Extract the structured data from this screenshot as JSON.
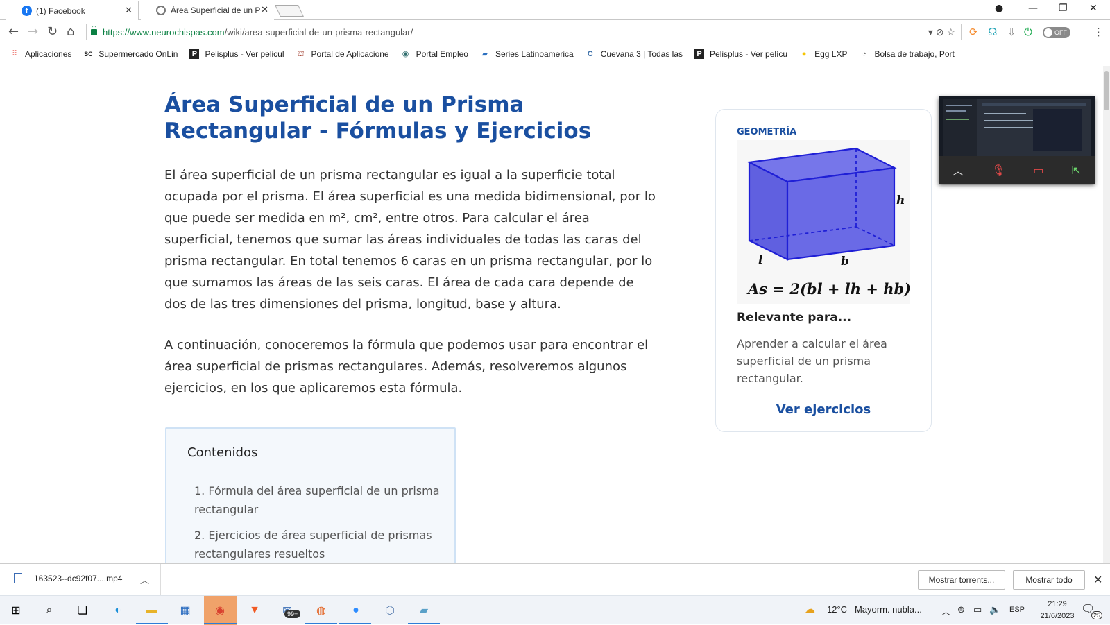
{
  "browser": {
    "tabs": [
      {
        "title": "(1) Facebook",
        "icon": "facebook-icon"
      },
      {
        "title": "Área Superficial de un Pri",
        "icon": "neurochispas-icon"
      }
    ],
    "url_host": "https://www.neurochispas.com",
    "url_path": "/wiki/area-superficial-de-un-prisma-rectangular/",
    "extension_toggle": "OFF"
  },
  "bookmarks": [
    {
      "label": "Aplicaciones",
      "icon": "apps-grid-icon",
      "color": "#e8453c"
    },
    {
      "label": "Supermercado OnLin",
      "icon": "sc-icon",
      "color": "#333333"
    },
    {
      "label": "Pelisplus - Ver pelicul",
      "icon": "pelisplus-icon",
      "color": "#222222"
    },
    {
      "label": "Portal de Aplicacione",
      "icon": "portal-icon",
      "color": "#a84b3c"
    },
    {
      "label": "Portal Empleo",
      "icon": "empleo-icon",
      "color": "#2f6d6d"
    },
    {
      "label": "Series Latinoamerica",
      "icon": "series-icon",
      "color": "#2a6fbf"
    },
    {
      "label": "Cuevana 3 | Todas las",
      "icon": "cuevana-icon",
      "color": "#3a6ea8"
    },
    {
      "label": "Pelisplus - Ver pelícu",
      "icon": "pelisplus-icon",
      "color": "#222222"
    },
    {
      "label": "Egg LXP",
      "icon": "egg-icon",
      "color": "#f5c400"
    },
    {
      "label": "Bolsa de trabajo, Port",
      "icon": "bolsa-icon",
      "color": "#666666"
    }
  ],
  "article": {
    "title": "Área Superficial de un Prisma Rectangular - Fórmulas y Ejercicios",
    "paragraph1": "El área superficial de un prisma rectangular es igual a la superficie total ocupada por el prisma. El área superficial es una medida bidimensional, por lo que puede ser medida en m², cm², entre otros. Para calcular el área superficial, tenemos que sumar las áreas individuales de todas las caras del prisma rectangular. En total tenemos 6 caras en un prisma rectangular, por lo que sumamos las áreas de las seis caras. El área de cada cara depende de dos de las tres dimensiones del prisma, longitud, base y altura.",
    "paragraph2": "A continuación, conoceremos la fórmula que podemos usar para encontrar el área superficial de prismas rectangulares. Además, resolveremos algunos ejercicios, en los que aplicaremos esta fórmula."
  },
  "toc": {
    "title": "Contenidos",
    "items": [
      "1.  Fórmula del área superficial de un prisma rectangular",
      "2.  Ejercicios de área superficial de prismas rectangulares resueltos"
    ]
  },
  "card": {
    "category": "GEOMETRÍA",
    "label_h": "h",
    "label_l": "l",
    "label_b": "b",
    "formula": "As = 2(bl + lh + hb)",
    "relevant_title": "Relevante para...",
    "relevant_desc": "Aprender a calcular el área superficial de un prisma rectangular.",
    "link": "Ver ejercicios",
    "prism_color": "#6a6ae6"
  },
  "downloads": {
    "file": "163523--dc92f07....mp4",
    "show_torrents": "Mostrar torrents...",
    "show_all": "Mostrar todo"
  },
  "taskbar": {
    "weather_temp": "12°C",
    "weather_desc": "Mayorm. nubla...",
    "language": "ESP",
    "time": "21:29",
    "date": "21/6/2023",
    "mail_badge": "99+",
    "notifications": "25"
  }
}
